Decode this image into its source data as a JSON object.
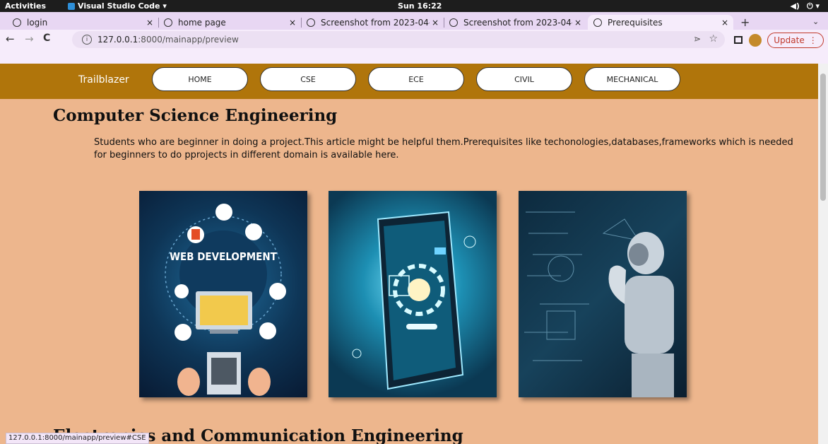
{
  "os_topbar": {
    "activities": "Activities",
    "app": "Visual Studio Code ▾",
    "clock": "Sun 16:22",
    "tray": [
      "◀)",
      "⏻ ▾"
    ]
  },
  "tabs": [
    {
      "label": "login",
      "close": "×"
    },
    {
      "label": "home page",
      "close": "×"
    },
    {
      "label": "Screenshot from 2023-04-",
      "close": "×"
    },
    {
      "label": "Screenshot from 2023-04-",
      "close": "×"
    },
    {
      "label": "Prerequisites",
      "close": "×"
    }
  ],
  "newtab": "+",
  "tabmenu": "⌄",
  "nav": {
    "back": "←",
    "forward": "→",
    "reload": "C"
  },
  "omnibox": {
    "info": "i",
    "host": "127.0.0.1",
    "path": ":8000/mainapp/preview",
    "send": "⋗",
    "star": "☆"
  },
  "update": {
    "label": "Update",
    "menu": "⋮"
  },
  "site": {
    "brand": "Trailblazer",
    "nav": [
      "HOME",
      "CSE",
      "ECE",
      "CIVIL",
      "MECHANICAL"
    ]
  },
  "content": {
    "title": "Computer Science Engineering",
    "description": "Students who are beginner in doing a project.This article might be helpful them.Prerequisites like techonologies,databases,frameworks which is needed for beginners to do pprojects in different domain is available here.",
    "images": [
      {
        "caption": "WEB DEVELOPMENT"
      },
      {
        "caption": ""
      },
      {
        "caption": ""
      }
    ],
    "next_title": "Electronics and Communication Engineering"
  },
  "status_url": "127.0.0.1:8000/mainapp/preview#CSE"
}
